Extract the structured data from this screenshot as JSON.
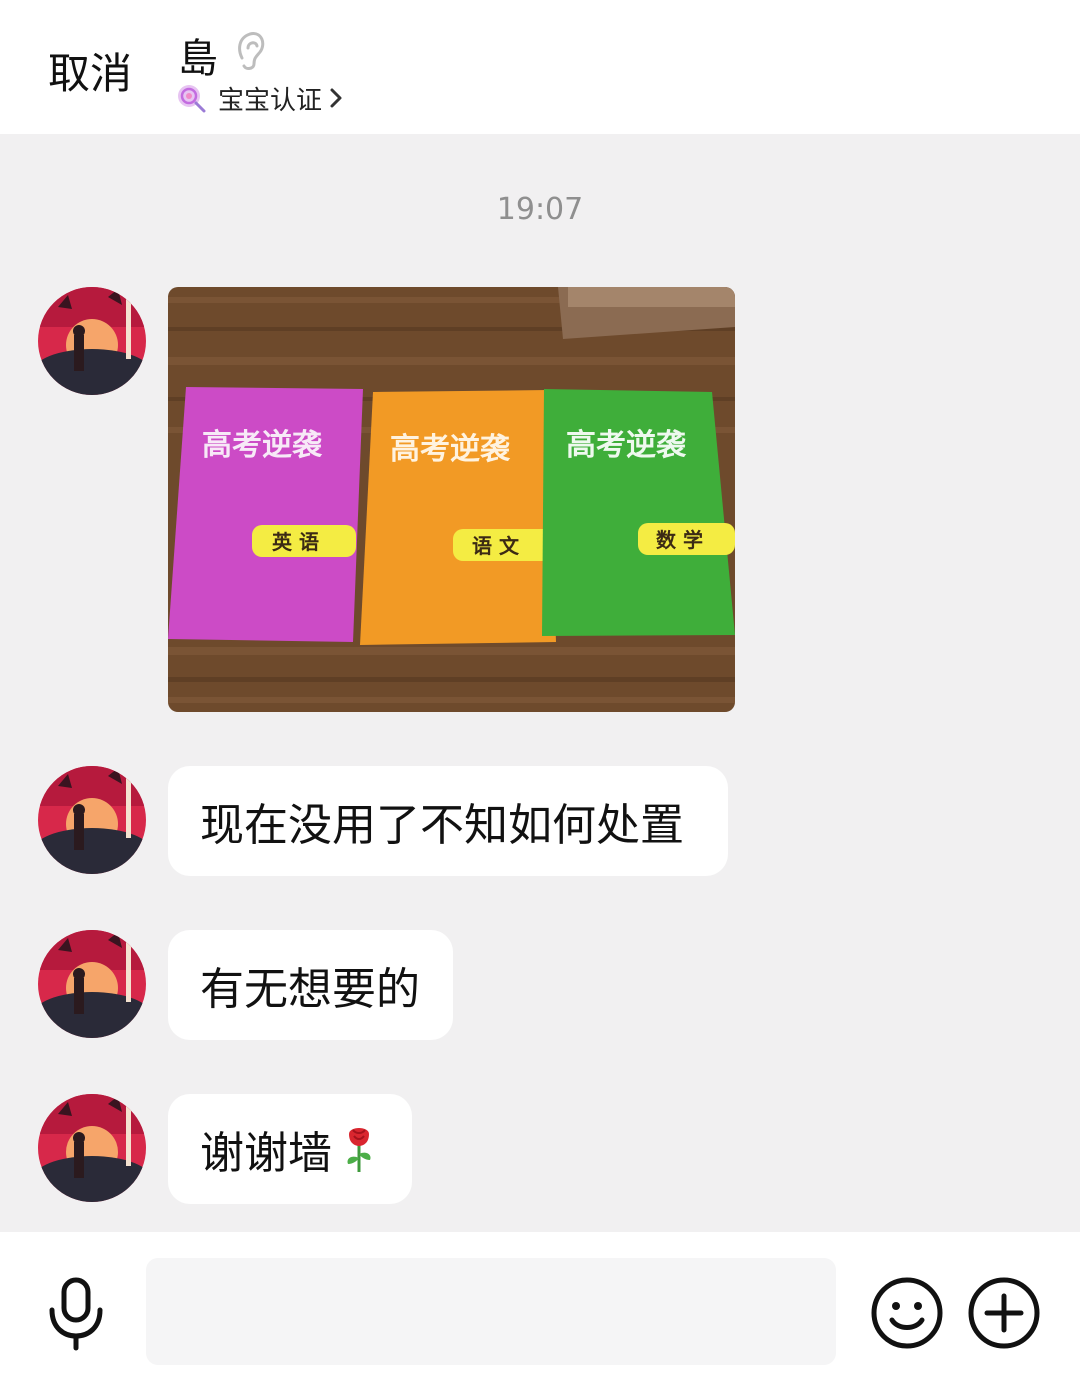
{
  "header": {
    "cancel_label": "取消",
    "title": "島",
    "verify_label": "宝宝认证"
  },
  "chat": {
    "timestamp": "19:07",
    "photo": {
      "books": [
        {
          "series": "高考逆袭",
          "subject": "英 语"
        },
        {
          "series": "高考逆袭",
          "subject": "语 文"
        },
        {
          "series": "高考逆袭",
          "subject": "数 学"
        }
      ]
    },
    "messages": [
      {
        "text": "现在没用了不知如何处置"
      },
      {
        "text": "有无想要的"
      },
      {
        "text": "谢谢墙"
      }
    ]
  },
  "input": {
    "placeholder": ""
  },
  "colors": {
    "background": "#f1f0f1",
    "bubble": "#ffffff",
    "book_pink": "#cc4bc6",
    "book_orange": "#f29a25",
    "book_green": "#3fae3a"
  }
}
